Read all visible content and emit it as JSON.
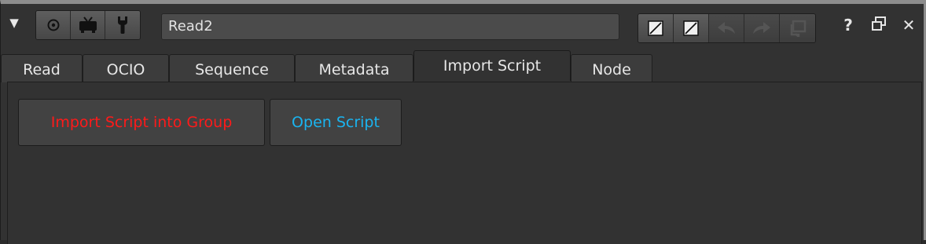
{
  "header": {
    "node_name": "Read2",
    "icons": {
      "collapse": "triangle-down-icon",
      "viewer": "circle-target-icon",
      "display": "tv-icon",
      "settings": "wrench-icon",
      "help": "question-icon",
      "float": "float-window-icon",
      "close": "close-icon"
    },
    "help_label": "?",
    "close_label": "✕"
  },
  "tabs": [
    {
      "label": "Read"
    },
    {
      "label": "OCIO"
    },
    {
      "label": "Sequence"
    },
    {
      "label": "Metadata"
    },
    {
      "label": "Import Script",
      "active": true
    },
    {
      "label": "Node"
    }
  ],
  "panel": {
    "import_button": "Import Script into Group",
    "open_button": "Open Script"
  },
  "colors": {
    "import_text": "#ff1a1a",
    "open_text": "#1ab4f0",
    "background": "#323232"
  }
}
